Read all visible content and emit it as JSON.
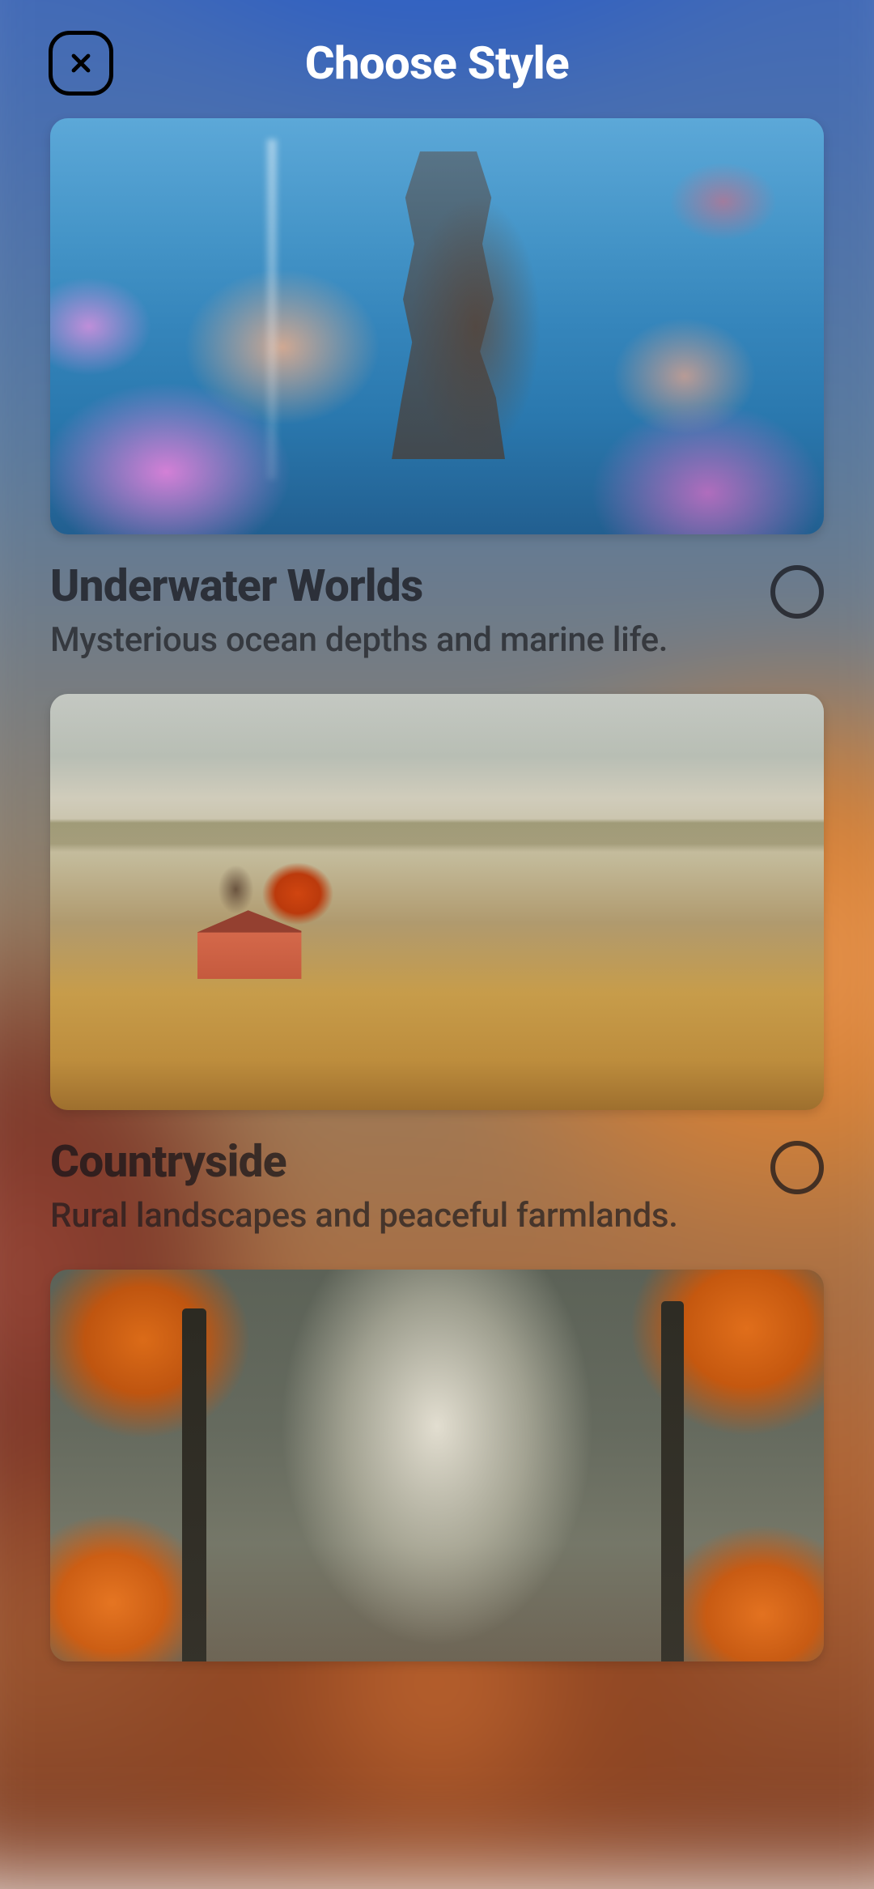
{
  "header": {
    "title": "Choose Style"
  },
  "styles": [
    {
      "id": "underwater",
      "title": "Underwater Worlds",
      "description": "Mysterious ocean depths and marine life.",
      "selected": false
    },
    {
      "id": "countryside",
      "title": "Countryside",
      "description": "Rural landscapes and peaceful farmlands.",
      "selected": false
    },
    {
      "id": "autumn",
      "title": "",
      "description": "",
      "selected": false
    }
  ]
}
